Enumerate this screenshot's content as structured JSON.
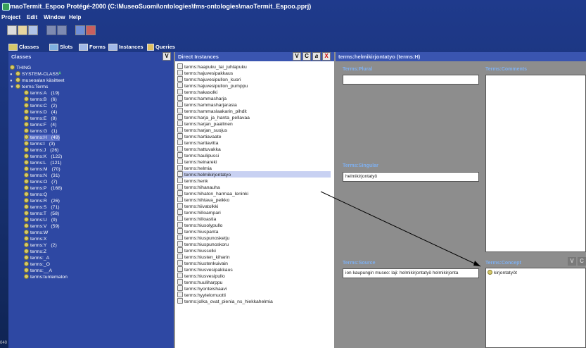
{
  "window": {
    "title": "maoTermit_Espoo  Protégé-2000    (C:\\MuseoSuomi\\ontologies\\fms-ontologies\\maoTermit_Espoo.pprj)"
  },
  "menu": [
    "Project",
    "Edit",
    "Window",
    "Help"
  ],
  "tabs": [
    "Classes",
    "Slots",
    "Forms",
    "Instances",
    "Queries"
  ],
  "classes_panel": {
    "header": "Classes",
    "button": "V",
    "tree": [
      {
        "label": "THING",
        "count": ""
      },
      {
        "label": "SYSTEM-CLASS",
        "count": ""
      },
      {
        "label": "museoalan käsitteet",
        "count": ""
      },
      {
        "label": "terms:Terms",
        "count": ""
      },
      {
        "label": "terms:A",
        "count": "(19)"
      },
      {
        "label": "terms:B",
        "count": "(6)"
      },
      {
        "label": "terms:C",
        "count": "(2)"
      },
      {
        "label": "terms:D",
        "count": "(4)"
      },
      {
        "label": "terms:E",
        "count": "(8)"
      },
      {
        "label": "terms:F",
        "count": "(4)"
      },
      {
        "label": "terms:G",
        "count": "(1)"
      },
      {
        "label": "terms:H",
        "count": "(49)"
      },
      {
        "label": "terms:I",
        "count": "(3)"
      },
      {
        "label": "terms:J",
        "count": "(26)"
      },
      {
        "label": "terms:K",
        "count": "(122)"
      },
      {
        "label": "terms:L",
        "count": "(121)"
      },
      {
        "label": "terms:M",
        "count": "(70)"
      },
      {
        "label": "terms:N",
        "count": "(31)"
      },
      {
        "label": "terms:O",
        "count": "(7)"
      },
      {
        "label": "terms:P",
        "count": "(168)"
      },
      {
        "label": "terms:Q",
        "count": ""
      },
      {
        "label": "terms:R",
        "count": "(26)"
      },
      {
        "label": "terms:S",
        "count": "(71)"
      },
      {
        "label": "terms:T",
        "count": "(58)"
      },
      {
        "label": "terms:U",
        "count": "(9)"
      },
      {
        "label": "terms:V",
        "count": "(59)"
      },
      {
        "label": "terms:W",
        "count": ""
      },
      {
        "label": "terms:X",
        "count": ""
      },
      {
        "label": "terms:Y",
        "count": "(2)"
      },
      {
        "label": "terms:Z",
        "count": ""
      },
      {
        "label": "terms:_A",
        "count": ""
      },
      {
        "label": "terms:_O",
        "count": ""
      },
      {
        "label": "terms:__A",
        "count": ""
      },
      {
        "label": "terms:tuntematon",
        "count": ""
      }
    ]
  },
  "instances_panel": {
    "header": "Direct Instances",
    "buttons": [
      "V",
      "C",
      "a",
      "X"
    ],
    "items": [
      "terms:haapuku_tai_juhlapuku",
      "terms:hajuvesipakkaus",
      "terms:hajuvesipullon_kuori",
      "terms:hajuvesipullon_pumppu",
      "terms:hakasolki",
      "terms:hammasharja",
      "terms:hammasharjarasia",
      "terms:hammaslaakarin_pihdit",
      "terms:harja_ja_hanta_pellavaa",
      "terms:harjan_paallinen",
      "terms:harjan_suojus",
      "terms:hartiavaate",
      "terms:hartiavitta",
      "terms:hattuvakka",
      "terms:haulipussi",
      "terms:heinareki",
      "terms:helmia",
      "terms:helmikirjontatyo",
      "terms:henk",
      "terms:hihanauha",
      "terms:hihaton_harmaa_leninki",
      "terms:hihtava_peikko",
      "terms:hiivatolkki",
      "terms:hilloampari",
      "terms:hilloastia",
      "terms:hiusolypullo",
      "terms:hiuspanta",
      "terms:hiuspunosketju",
      "terms:hiuspunoskoru",
      "terms:hiussolki",
      "terms:hiusten_kiharin",
      "terms:hiustenkuivain",
      "terms:hiusvesipakkaus",
      "terms:hiusvesipullo",
      "terms:huuliharppu",
      "terms:hyonteishaavi",
      "terms:hyytelomuotti",
      "terms:jolka_ovat_pienia_ns_hiekkahelmia"
    ],
    "selected_index": 17
  },
  "form_panel": {
    "header": "terms:helmikirjontatyo  (terms:H)",
    "plural_label": "Terms:Plural",
    "plural_value": "",
    "comments_label": "Terms:Comments",
    "singular_label": "Terms:Singular",
    "singular_value": "helmikirjontatyö",
    "source_label": "Terms:Source",
    "source_value": "ion kaupungin museo: laji: helmikirjontatyö helmikirjonta",
    "concept_label": "Terms:Concept",
    "concept_buttons": [
      "V",
      "C"
    ],
    "concept_value": "kirjontatyöt"
  },
  "footer_text": "040"
}
